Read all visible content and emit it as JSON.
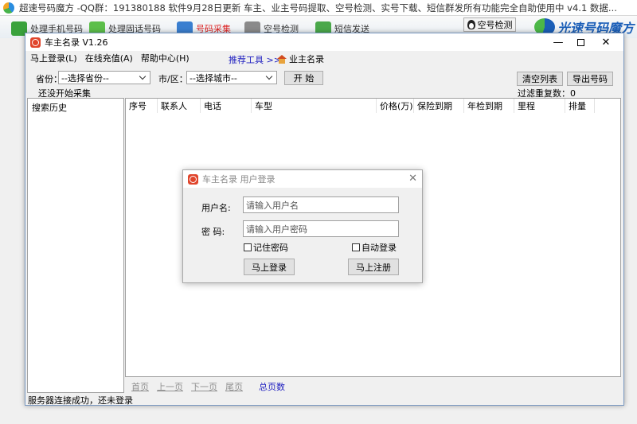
{
  "background": {
    "title": "超速号码魔方 -QQ群：191380188 软件9月28日更新 车主、业主号码提取、空号检测、实号下载、短信群发所有功能完全自助使用中  v4.1 数据...",
    "tools": [
      "处理手机号码",
      "处理固话号码",
      "号码采集",
      "空号检测",
      "短信发送"
    ],
    "kong_button": "空号检测",
    "brand": "光速号码魔方"
  },
  "window": {
    "title": "车主名录 V1.26",
    "menu": [
      "马上登录(L)",
      "在线充值(A)",
      "帮助中心(H)"
    ],
    "tools_link": "推荐工具 >>",
    "owner_link": "业主名录"
  },
  "filters": {
    "province_label": "省份：",
    "province_value": "--选择省份--",
    "city_label": "市/区：",
    "city_value": "--选择城市--",
    "start_button": "开 始",
    "clear_button": "清空列表",
    "export_button": "导出号码",
    "status_left": "还没开始采集",
    "dup_label": "过滤重复数：",
    "dup_count": "0"
  },
  "history": {
    "header": "搜索历史"
  },
  "grid": {
    "columns": [
      "序号",
      "联系人",
      "电话",
      "车型",
      "价格(万)",
      "保险到期",
      "年检到期",
      "里程",
      "排量"
    ]
  },
  "pager": {
    "first": "首页",
    "prev": "上一页",
    "next": "下一页",
    "last": "尾页",
    "total": "总页数"
  },
  "status": "服务器连接成功，还未登录",
  "login": {
    "title": "车主名录 用户登录",
    "user_label": "用户名:",
    "user_placeholder": "请输入用户名",
    "pass_label": "密  码:",
    "pass_placeholder": "请输入用户密码",
    "remember": "记住密码",
    "auto": "自动登录",
    "login_button": "马上登录",
    "register_button": "马上注册"
  }
}
